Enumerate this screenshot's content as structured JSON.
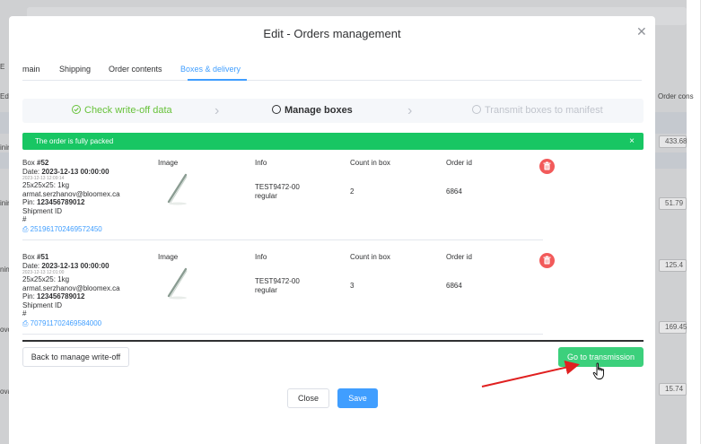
{
  "background": {
    "left_labels": [
      "E",
      "Ed",
      "inir",
      "inir",
      "ninr",
      "ninr",
      "ovol",
      "oval"
    ],
    "order_col_header": "Order cons",
    "amounts": [
      "433.68",
      "51.79",
      "125.4",
      "169.45",
      "15.74"
    ]
  },
  "modal": {
    "title": "Edit - Orders management",
    "tabs": [
      {
        "label": "main"
      },
      {
        "label": "Shipping"
      },
      {
        "label": "Order contents"
      },
      {
        "label": "Boxes & delivery"
      }
    ],
    "steps": [
      {
        "label": "Check write-off data",
        "status": "done"
      },
      {
        "label": "Manage boxes",
        "status": "current"
      },
      {
        "label": "Transmit boxes to manifest",
        "status": "wait"
      }
    ],
    "alert": {
      "text": "The order is fully packed",
      "close": "×"
    },
    "columns": {
      "image": "Image",
      "info": "Info",
      "count": "Count in box",
      "order": "Order id"
    },
    "boxes": [
      {
        "box_prefix": "Box ",
        "box_number": "#52",
        "date_label": "Date: ",
        "date": "2023-12-13 00:00:00",
        "created": "2023-12-13 12:09:14",
        "size": "25x25x25: 1kg",
        "email": "armat.serzhanov@bloomex.ca",
        "pin_label": "Pin: ",
        "pin": "123456789012",
        "shipment_label": "Shipment ID",
        "shipment_hash": "#",
        "shipment_id": "251961702469572450",
        "sku": "TEST9472-00",
        "variant": "regular",
        "count": "2",
        "order_id": "6864"
      },
      {
        "box_prefix": "Box ",
        "box_number": "#51",
        "date_label": "Date: ",
        "date": "2023-12-13 00:00:00",
        "created": "2023-12-13 12:01:00",
        "size": "25x25x25: 1kg",
        "email": "armat.serzhanov@bloomex.ca",
        "pin_label": "Pin: ",
        "pin": "123456789012",
        "shipment_label": "Shipment ID",
        "shipment_hash": "#",
        "shipment_id": "707911702469584000",
        "sku": "TEST9472-00",
        "variant": "regular",
        "count": "3",
        "order_id": "6864"
      }
    ],
    "buttons": {
      "back": "Back to manage write-off",
      "go": "Go to transmission",
      "close": "Close",
      "save": "Save"
    }
  },
  "colors": {
    "primary": "#409eff",
    "success": "#18c663",
    "go_button": "#3cd07c",
    "danger": "#f25a5a",
    "annotation_arrow": "#e02020"
  }
}
